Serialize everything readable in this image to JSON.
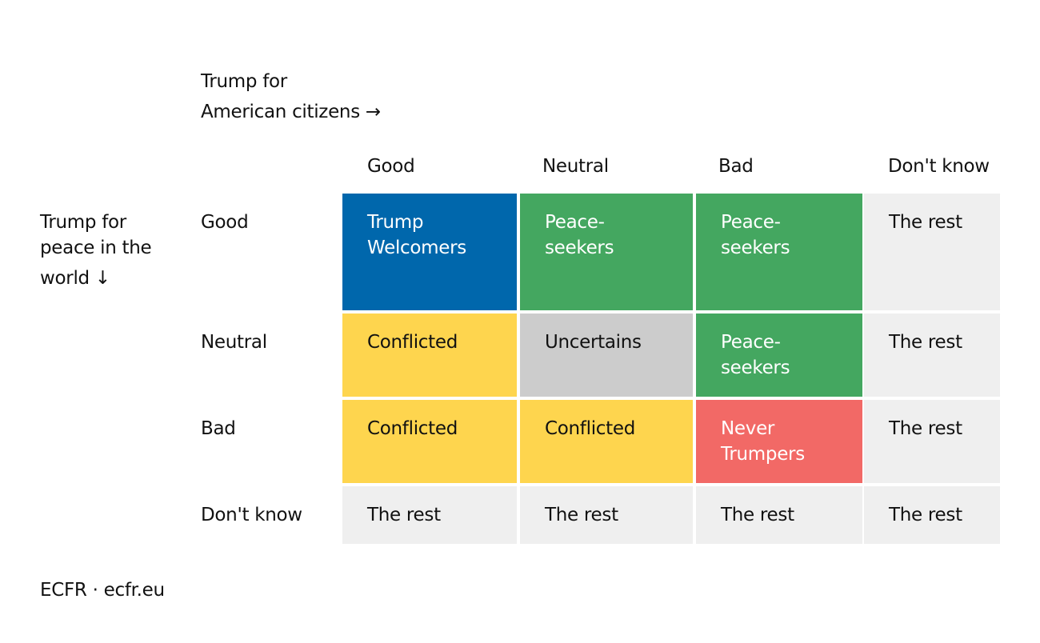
{
  "x_axis_title": [
    "Trump for",
    "American citizens →"
  ],
  "y_axis_title": [
    "Trump for",
    "peace in the",
    "world ↓"
  ],
  "columns": [
    "Good",
    "Neutral",
    "Bad",
    "Don't know"
  ],
  "rows": [
    "Good",
    "Neutral",
    "Bad",
    "Don't know"
  ],
  "colors": {
    "Trump Welcomers": "#0067ac",
    "Peace-seekers": "#44a760",
    "Conflicted": "#fed54e",
    "Uncertains": "#cccccc",
    "Never Trumpers": "#f26966",
    "The rest": "#efefef"
  },
  "cells": [
    [
      "Trump\nWelcomers",
      "Peace-\nseekers",
      "Peace-\nseekers",
      "The rest"
    ],
    [
      "Conflicted",
      "Uncertains",
      "Peace-\nseekers",
      "The rest"
    ],
    [
      "Conflicted",
      "Conflicted",
      "Never\nTrumpers",
      "The rest"
    ],
    [
      "The rest",
      "The rest",
      "The rest",
      "The rest"
    ]
  ],
  "cell_groups": [
    [
      "Trump Welcomers",
      "Peace-seekers",
      "Peace-seekers",
      "The rest"
    ],
    [
      "Conflicted",
      "Uncertains",
      "Peace-seekers",
      "The rest"
    ],
    [
      "Conflicted",
      "Conflicted",
      "Never Trumpers",
      "The rest"
    ],
    [
      "The rest",
      "The rest",
      "The rest",
      "The rest"
    ]
  ],
  "source": "ECFR · ecfr.eu"
}
